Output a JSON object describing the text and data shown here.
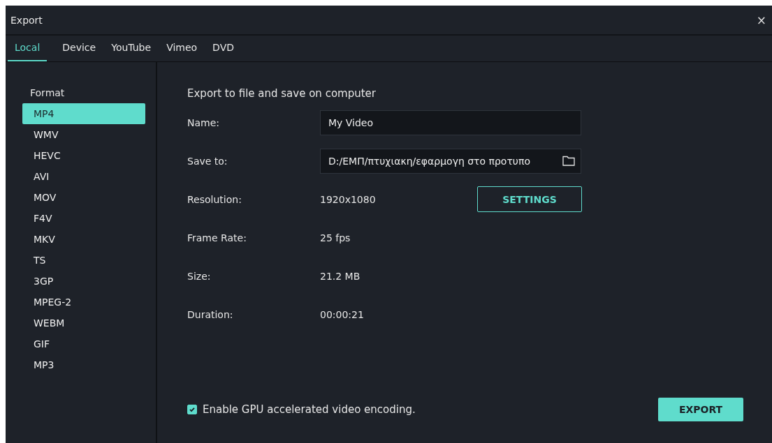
{
  "window": {
    "title": "Export",
    "close": "×"
  },
  "tabs": [
    {
      "label": "Local",
      "selected": true
    },
    {
      "label": "Device",
      "selected": false
    },
    {
      "label": "YouTube",
      "selected": false
    },
    {
      "label": "Vimeo",
      "selected": false
    },
    {
      "label": "DVD",
      "selected": false
    }
  ],
  "sidebar": {
    "heading": "Format",
    "items": [
      {
        "label": "MP4",
        "selected": true
      },
      {
        "label": "WMV",
        "selected": false
      },
      {
        "label": "HEVC",
        "selected": false
      },
      {
        "label": "AVI",
        "selected": false
      },
      {
        "label": "MOV",
        "selected": false
      },
      {
        "label": "F4V",
        "selected": false
      },
      {
        "label": "MKV",
        "selected": false
      },
      {
        "label": "TS",
        "selected": false
      },
      {
        "label": "3GP",
        "selected": false
      },
      {
        "label": "MPEG-2",
        "selected": false
      },
      {
        "label": "WEBM",
        "selected": false
      },
      {
        "label": "GIF",
        "selected": false
      },
      {
        "label": "MP3",
        "selected": false
      }
    ]
  },
  "main": {
    "heading": "Export to file and save on computer",
    "rows": [
      {
        "kind": "input",
        "label": "Name:",
        "value": "My Video"
      },
      {
        "kind": "path",
        "label": "Save to:",
        "value": "D:/ΕΜΠ/πτυχιακη/εφαρμογη στο προτυπο"
      },
      {
        "kind": "button",
        "label": "Resolution:",
        "value": "1920x1080",
        "button": "SETTINGS"
      },
      {
        "kind": "text",
        "label": "Frame Rate:",
        "value": "25 fps"
      },
      {
        "kind": "text",
        "label": "Size:",
        "value": "21.2 MB"
      },
      {
        "kind": "text",
        "label": "Duration:",
        "value": "00:00:21"
      }
    ],
    "gpu": {
      "label": "Enable GPU accelerated video encoding.",
      "checked": true
    },
    "export_button": "EXPORT"
  }
}
